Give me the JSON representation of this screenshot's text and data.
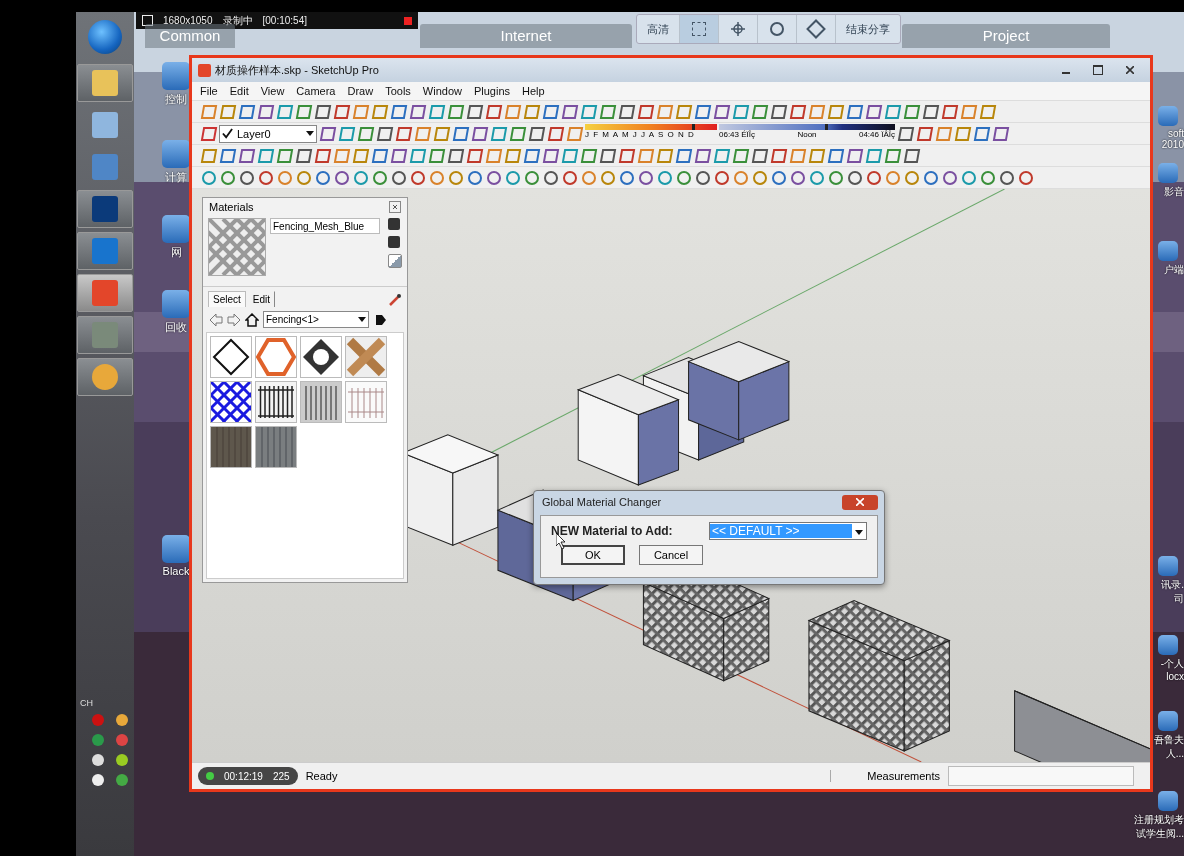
{
  "recorder_bar": {
    "resolution": "1680x1050",
    "status": "录制中",
    "timer": "[00:10:54]"
  },
  "share_toolbar": {
    "quality": "高清",
    "end": "结束分享"
  },
  "desktop_tabs": [
    "Common",
    "Internet",
    "Project"
  ],
  "desktop_icons_left": [
    "控制",
    "计算",
    "网",
    "回收",
    "Black"
  ],
  "desktop_icons_right": [
    {
      "lines": [
        "soft",
        "2010"
      ]
    },
    {
      "lines": [
        "影音"
      ]
    },
    {
      "lines": [
        "户端"
      ]
    },
    {
      "lines": [
        "讯录.",
        "司"
      ]
    },
    {
      "lines": [
        "-个人",
        "locx"
      ]
    },
    {
      "lines": [
        "吾鲁夫",
        "人..."
      ]
    },
    {
      "lines": [
        "注册规划考",
        "试学生阅..."
      ]
    }
  ],
  "tray": {
    "language": "CH"
  },
  "window": {
    "title": "材质操作样本.skp - SketchUp Pro",
    "menu": [
      "File",
      "Edit",
      "View",
      "Camera",
      "Draw",
      "Tools",
      "Window",
      "Plugins",
      "Help"
    ],
    "layer": {
      "name": "Layer0",
      "checked": true
    },
    "shadow": {
      "date": {
        "months": "J F M A M J J A S O N D",
        "level": 0.83
      },
      "time": {
        "sunrise": "06:43 ÉÏÎç",
        "noon": "Noon",
        "sunset": "04:46 ÏÂÎç",
        "level": 0.62
      }
    },
    "status": "Ready",
    "measurements_label": "Measurements"
  },
  "recording_badge": {
    "time": "00:12:19",
    "viewers": "225"
  },
  "materials": {
    "title": "Materials",
    "name": "Fencing_Mesh_Blue",
    "tabs": [
      {
        "label": "Select",
        "selected": true
      },
      {
        "label": "Edit",
        "selected": false
      }
    ],
    "collection": "Fencing<1>",
    "swatches": [
      {
        "kind": "diamond"
      },
      {
        "kind": "orange-hex"
      },
      {
        "kind": "dark-ring"
      },
      {
        "kind": "wood-cross"
      },
      {
        "kind": "blue-mesh"
      },
      {
        "kind": "black-fence"
      },
      {
        "kind": "gray-fence"
      },
      {
        "kind": "white-fence"
      },
      {
        "kind": "dark-wood"
      },
      {
        "kind": "gray-wood"
      }
    ]
  },
  "dialog": {
    "title": "Global Material Changer",
    "label": "NEW Material to Add:",
    "value": "<< DEFAULT >>",
    "buttons": [
      "OK",
      "Cancel"
    ]
  }
}
